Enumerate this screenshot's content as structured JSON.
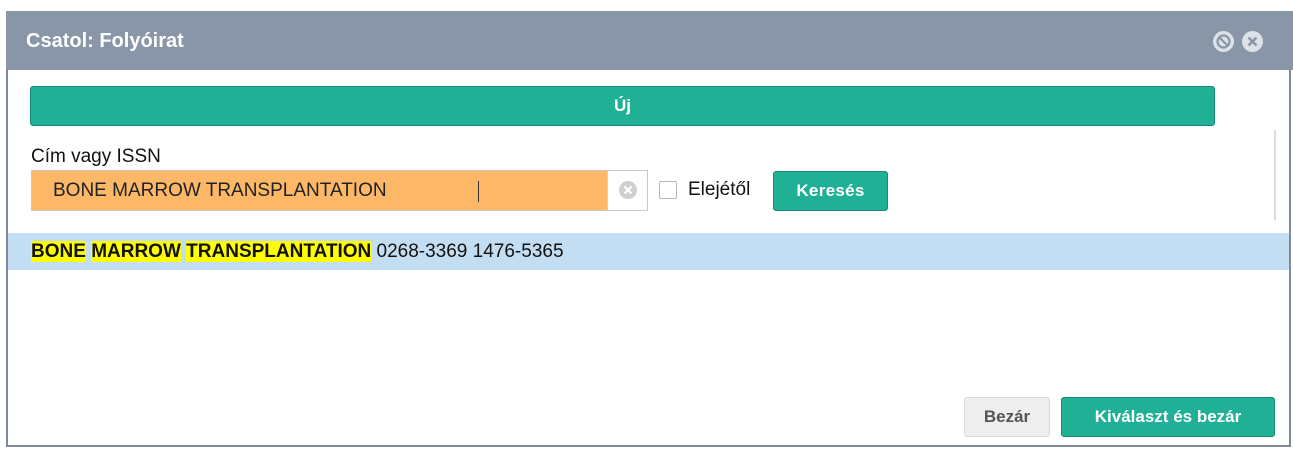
{
  "dialog": {
    "title": "Csatol: Folyóirat",
    "minimize_icon": "no-entry-circle-icon",
    "close_icon": "close-circle-icon"
  },
  "toolbar": {
    "new_label": "Új"
  },
  "search": {
    "label": "Cím vagy ISSN",
    "value": "BONE MARROW TRANSPLANTATION",
    "clear_icon": "clear-circle-icon",
    "checkbox_label": "Elejétől",
    "checkbox_checked": false,
    "button_label": "Keresés"
  },
  "results": [
    {
      "words": [
        "BONE",
        "MARROW",
        "TRANSPLANTATION"
      ],
      "issn_text": "0268-3369 1476-5365"
    }
  ],
  "footer": {
    "close_label": "Bezár",
    "select_close_label": "Kiválaszt és bezár"
  },
  "colors": {
    "titlebar": "#8996a8",
    "accent": "#20b096",
    "input_bg": "#fcb867",
    "selected_row": "#c3ddf2",
    "highlight": "#ffff00"
  }
}
